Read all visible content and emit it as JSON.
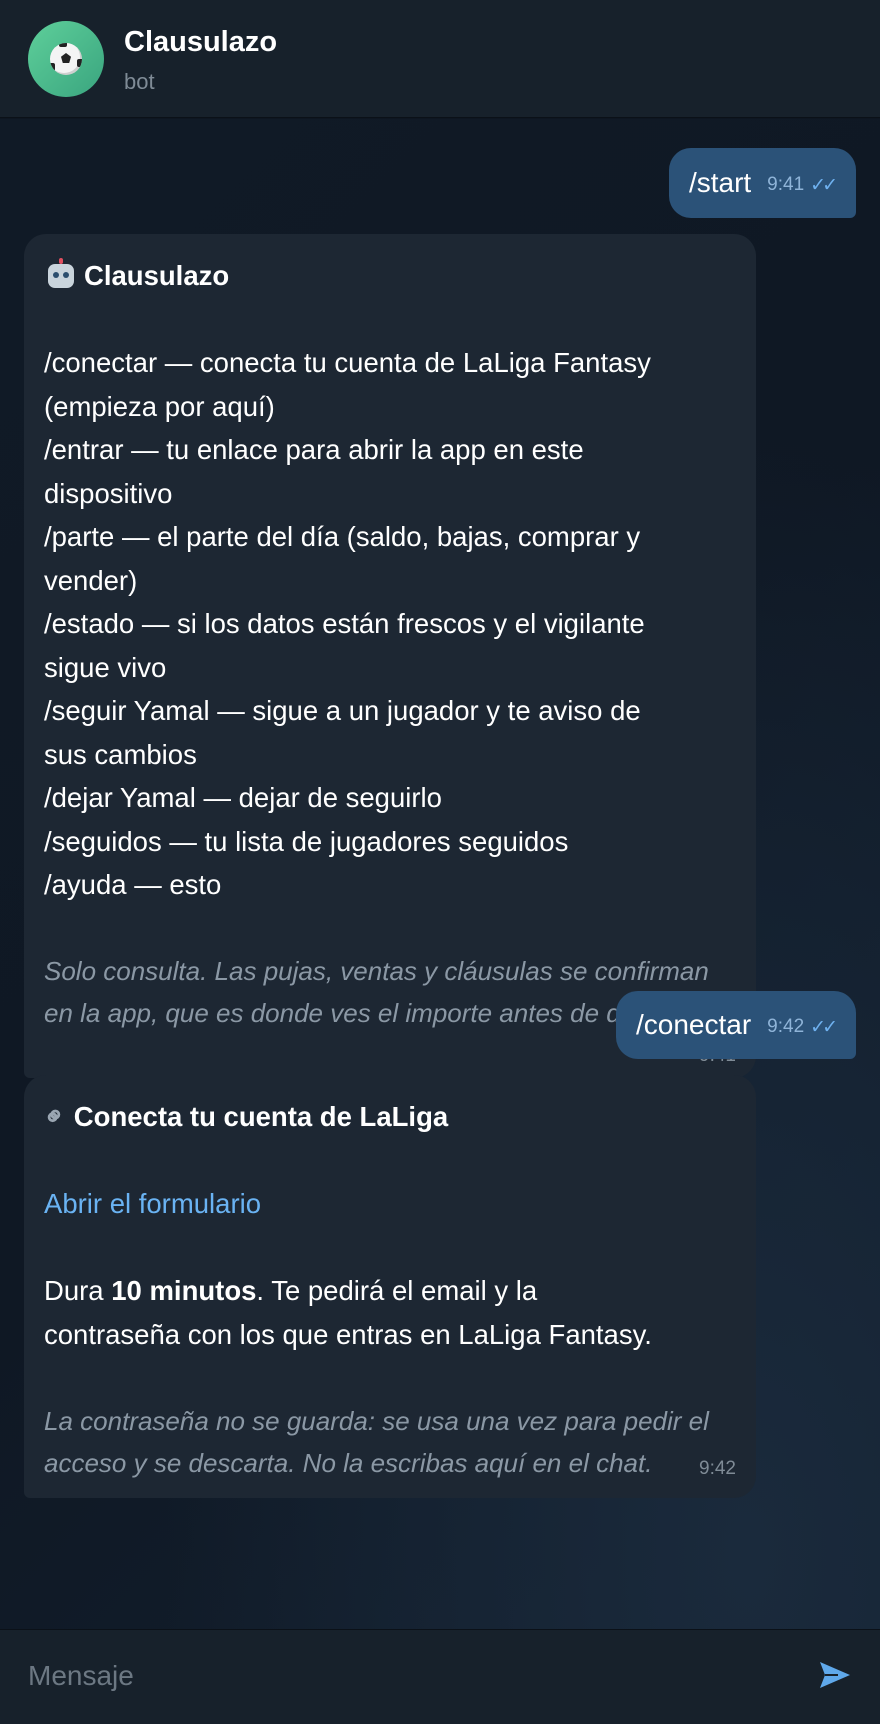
{
  "header": {
    "avatar_icon": "soccer-ball-icon",
    "title": "Clausulazo",
    "subtitle": "bot"
  },
  "messages": [
    {
      "direction": "out",
      "text": "/start",
      "time": "9:41",
      "status": "read"
    },
    {
      "direction": "in",
      "icon": "robot-icon",
      "title": "Clausulazo",
      "lines": [
        "/conectar — conecta tu cuenta de LaLiga Fantasy",
        "(empieza por aquí)",
        "/entrar — tu enlace para abrir la app en este",
        "dispositivo",
        "/parte — el parte del día (saldo, bajas, comprar y",
        "vender)",
        "/estado — si los datos están frescos y el vigilante",
        "sigue vivo",
        "/seguir Yamal — sigue a un jugador y te aviso de",
        "sus cambios",
        "/dejar Yamal — dejar de seguirlo",
        "/seguidos — tu lista de jugadores seguidos",
        "/ayuda — esto"
      ],
      "note": [
        "Solo consulta. Las pujas, ventas y cláusulas se confirman",
        "en la app, que es donde ves el importe antes de darle."
      ],
      "time": "9:41"
    },
    {
      "direction": "out",
      "text": "/conectar",
      "time": "9:42",
      "status": "read"
    },
    {
      "direction": "in",
      "icon": "link-icon",
      "title": "Conecta tu cuenta de LaLiga",
      "link": "Abrir el formulario",
      "body_prefix": "Dura ",
      "body_bold": "10 minutos",
      "body_suffix": ". Te pedirá el email y la",
      "body_line2": "contraseña con los que entras en LaLiga Fantasy.",
      "note": [
        "La contraseña no se guarda: se usa una vez para pedir el",
        "acceso y se descarta. No la escribas aquí en el chat."
      ],
      "time": "9:42"
    }
  ],
  "composer": {
    "placeholder": "Mensaje",
    "send_icon": "send-icon"
  },
  "colors": {
    "background": "#0e1621",
    "header": "#17212b",
    "outgoing_bubble": "#2b5278",
    "incoming_bubble": "#1d2733",
    "link": "#6ab3f3",
    "read_check": "#6fb1ef"
  }
}
